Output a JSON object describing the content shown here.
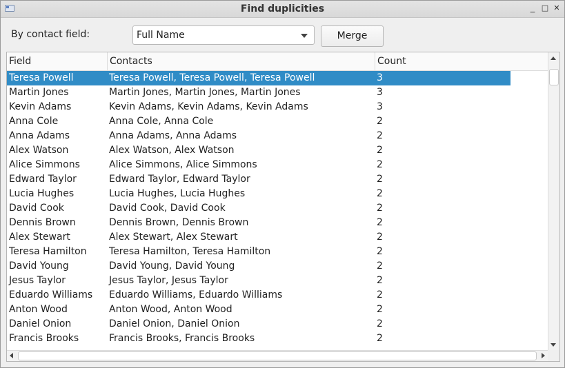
{
  "window": {
    "title": "Find duplicities",
    "minimize_label": "_",
    "maximize_label": "□",
    "close_label": "✕"
  },
  "toolbar": {
    "field_label": "By contact field:",
    "field_value": "Full Name",
    "merge_label": "Merge"
  },
  "table": {
    "columns": [
      "Field",
      "Contacts",
      "Count"
    ],
    "rows": [
      {
        "field": "Teresa Powell",
        "contacts": "Teresa Powell, Teresa Powell, Teresa Powell",
        "count": "3",
        "selected": true
      },
      {
        "field": "Martin Jones",
        "contacts": "Martin Jones, Martin Jones, Martin Jones",
        "count": "3"
      },
      {
        "field": "Kevin Adams",
        "contacts": "Kevin Adams, Kevin Adams, Kevin Adams",
        "count": "3"
      },
      {
        "field": "Anna Cole",
        "contacts": "Anna Cole, Anna Cole",
        "count": "2"
      },
      {
        "field": "Anna Adams",
        "contacts": "Anna Adams, Anna Adams",
        "count": "2"
      },
      {
        "field": "Alex Watson",
        "contacts": "Alex Watson, Alex Watson",
        "count": "2"
      },
      {
        "field": "Alice Simmons",
        "contacts": "Alice Simmons, Alice Simmons",
        "count": "2"
      },
      {
        "field": "Edward Taylor",
        "contacts": "Edward Taylor, Edward Taylor",
        "count": "2"
      },
      {
        "field": "Lucia Hughes",
        "contacts": "Lucia Hughes, Lucia Hughes",
        "count": "2"
      },
      {
        "field": "David Cook",
        "contacts": "David Cook, David Cook",
        "count": "2"
      },
      {
        "field": "Dennis Brown",
        "contacts": "Dennis Brown, Dennis Brown",
        "count": "2"
      },
      {
        "field": "Alex Stewart",
        "contacts": "Alex Stewart, Alex Stewart",
        "count": "2"
      },
      {
        "field": "Teresa Hamilton",
        "contacts": "Teresa Hamilton, Teresa Hamilton",
        "count": "2"
      },
      {
        "field": "David Young",
        "contacts": "David Young, David Young",
        "count": "2"
      },
      {
        "field": "Jesus Taylor",
        "contacts": "Jesus Taylor, Jesus Taylor",
        "count": "2"
      },
      {
        "field": "Eduardo Williams",
        "contacts": "Eduardo Williams, Eduardo Williams",
        "count": "2"
      },
      {
        "field": "Anton Wood",
        "contacts": "Anton Wood, Anton Wood",
        "count": "2"
      },
      {
        "field": "Daniel Onion",
        "contacts": "Daniel Onion, Daniel Onion",
        "count": "2"
      },
      {
        "field": "Francis Brooks",
        "contacts": "Francis Brooks, Francis Brooks",
        "count": "2"
      }
    ]
  },
  "colors": {
    "selection": "#308cc6",
    "window_bg": "#efefef"
  }
}
